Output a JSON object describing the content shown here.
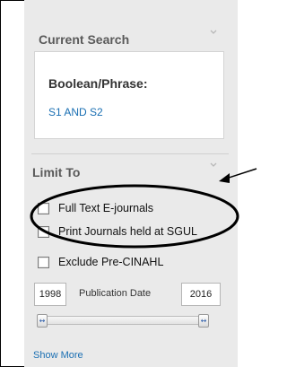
{
  "current_search": {
    "heading": "Current Search",
    "boolean_label": "Boolean/Phrase:",
    "boolean_value": "S1 AND S2"
  },
  "limit_to": {
    "heading": "Limit To",
    "options": [
      {
        "label": "Full Text E-journals",
        "checked": false
      },
      {
        "label": "Print Journals held at SGUL",
        "checked": false
      },
      {
        "label": "Exclude Pre-CINAHL",
        "checked": false
      }
    ]
  },
  "publication_date": {
    "from": "1998",
    "label": "Publication Date",
    "to": "2016"
  },
  "show_more_label": "Show More",
  "icons": {
    "collapse": "chevron-down-icon",
    "slider_handle": "double-arrow-icon"
  },
  "colors": {
    "panel": "#eaeaea",
    "link": "#1a6fb3",
    "annotation": "#000000"
  }
}
